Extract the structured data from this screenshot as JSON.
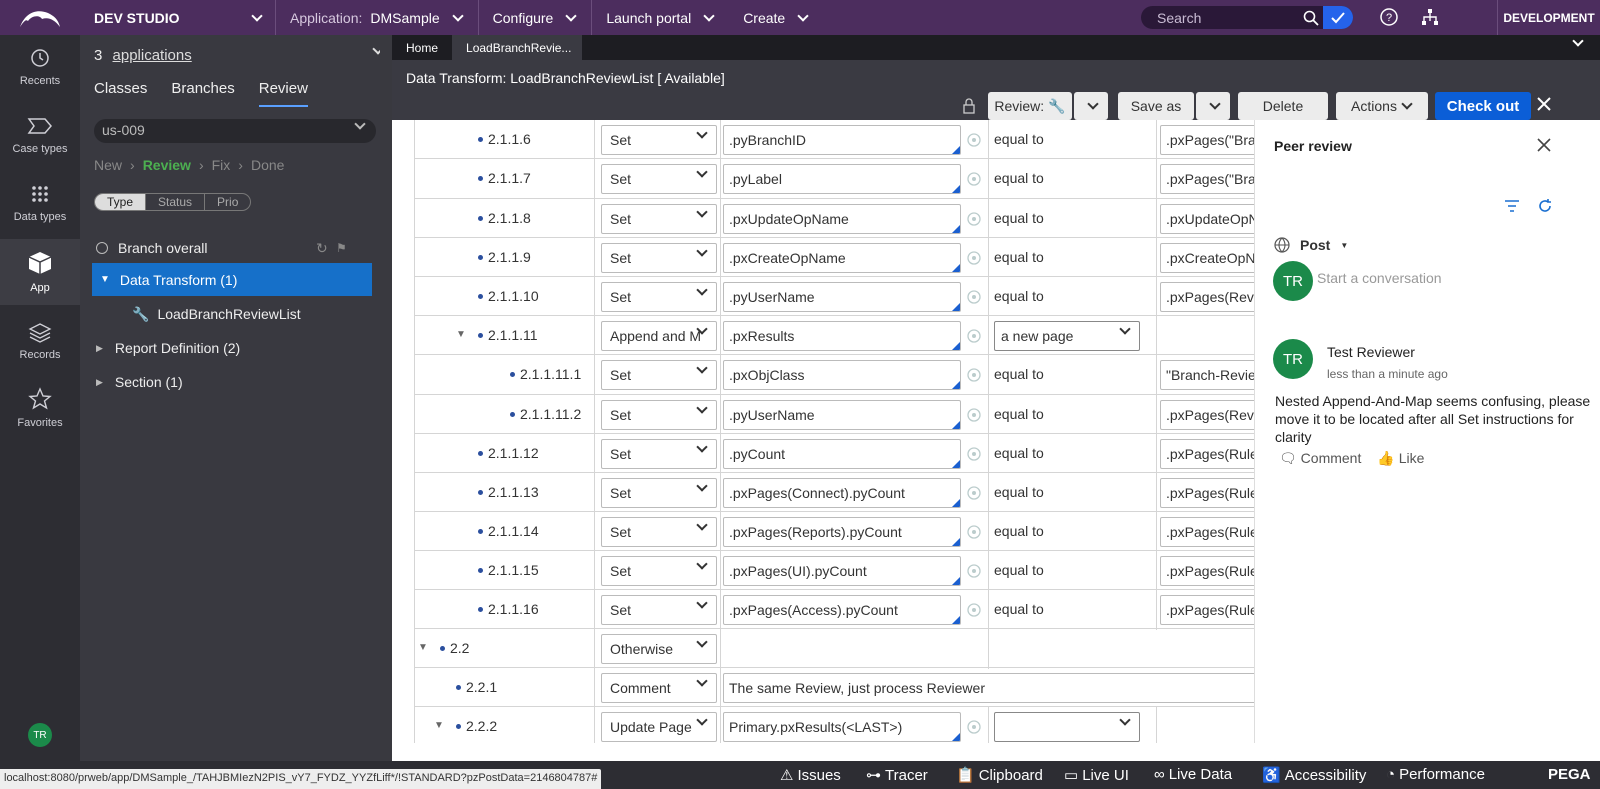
{
  "topbar": {
    "studio": "DEV STUDIO",
    "application_label": "Application:",
    "application_value": "DMSample",
    "configure": "Configure",
    "launch_portal": "Launch portal",
    "create": "Create",
    "search_placeholder": "Search",
    "environment": "DEVELOPMENT"
  },
  "rail": {
    "items": [
      {
        "label": "Recents",
        "icon": "history-icon"
      },
      {
        "label": "Case types",
        "icon": "case-types-icon"
      },
      {
        "label": "Data types",
        "icon": "data-types-icon"
      },
      {
        "label": "App",
        "icon": "app-cube-icon",
        "active": true
      },
      {
        "label": "Records",
        "icon": "records-icon"
      },
      {
        "label": "Favorites",
        "icon": "star-icon"
      }
    ],
    "avatar": "TR"
  },
  "panel": {
    "apps_count": "3",
    "apps_link": "applications",
    "tabs": [
      "Classes",
      "Branches",
      "Review"
    ],
    "selected_tab": "Review",
    "branch": "us-009",
    "flow": [
      "New",
      "Review",
      "Fix",
      "Done"
    ],
    "flow_current": "Review",
    "segments": [
      "Type",
      "Status",
      "Prio"
    ],
    "segment_selected": "Type",
    "branch_overall": "Branch overall",
    "tree": [
      {
        "label": "Data Transform (1)"
      },
      {
        "label": "LoadBranchReviewList"
      },
      {
        "label": "Report Definition (2)"
      },
      {
        "label": "Section (1)"
      }
    ]
  },
  "tabs": {
    "home": "Home",
    "current": "LoadBranchRevie..."
  },
  "header": {
    "title": "Data Transform: LoadBranchReviewList  [ Available]",
    "review": "Review:",
    "save_as": "Save as",
    "delete": "Delete",
    "actions": "Actions",
    "check_out": "Check out"
  },
  "grid": {
    "rows": [
      {
        "num": "2.1.1.6",
        "action": "Set",
        "target": ".pyBranchID",
        "op": "equal to",
        "value": ".pxPages(\"Bran"
      },
      {
        "num": "2.1.1.7",
        "action": "Set",
        "target": ".pyLabel",
        "op": "equal to",
        "value": ".pxPages(\"Bran"
      },
      {
        "num": "2.1.1.8",
        "action": "Set",
        "target": ".pxUpdateOpName",
        "op": "equal to",
        "value": ".pxUpdateOpN"
      },
      {
        "num": "2.1.1.9",
        "action": "Set",
        "target": ".pxCreateOpName",
        "op": "equal to",
        "value": ".pxCreateOpN"
      },
      {
        "num": "2.1.1.10",
        "action": "Set",
        "target": ".pyUserName",
        "op": "equal to",
        "value": ".pxPages(Revie"
      },
      {
        "num": "2.1.1.11",
        "action": "Append and M",
        "target": ".pxResults",
        "op": "a new page",
        "value": ""
      },
      {
        "num": "2.1.1.11.1",
        "action": "Set",
        "target": ".pxObjClass",
        "op": "equal to",
        "value": "\"Branch-Revie"
      },
      {
        "num": "2.1.1.11.2",
        "action": "Set",
        "target": ".pyUserName",
        "op": "equal to",
        "value": ".pxPages(Revie"
      },
      {
        "num": "2.1.1.12",
        "action": "Set",
        "target": ".pyCount",
        "op": "equal to",
        "value": ".pxPages(Rules"
      },
      {
        "num": "2.1.1.13",
        "action": "Set",
        "target": ".pxPages(Connect).pyCount",
        "op": "equal to",
        "value": ".pxPages(Rules"
      },
      {
        "num": "2.1.1.14",
        "action": "Set",
        "target": ".pxPages(Reports).pyCount",
        "op": "equal to",
        "value": ".pxPages(Rules"
      },
      {
        "num": "2.1.1.15",
        "action": "Set",
        "target": ".pxPages(UI).pyCount",
        "op": "equal to",
        "value": ".pxPages(Rules"
      },
      {
        "num": "2.1.1.16",
        "action": "Set",
        "target": ".pxPages(Access).pyCount",
        "op": "equal to",
        "value": ".pxPages(Rules"
      },
      {
        "num": "2.2",
        "action": "Otherwise",
        "target": "",
        "op": "",
        "value": ""
      },
      {
        "num": "2.2.1",
        "action": "Comment",
        "target": "The same Review, just process Reviewer",
        "op": "",
        "value": ""
      },
      {
        "num": "2.2.2",
        "action": "Update Page",
        "target": "Primary.pxResults(<LAST>)",
        "op": "",
        "value": ""
      }
    ]
  },
  "peer": {
    "title": "Peer review",
    "post": "Post",
    "start": "Start a conversation",
    "avatar": "TR",
    "comment": {
      "author": "Test Reviewer",
      "time": "less than a minute ago",
      "text": "Nested Append-And-Map seems confusing, please move it to be located after all Set instructions for clarity",
      "comment_label": "Comment",
      "like_label": "Like"
    }
  },
  "status": {
    "url": "localhost:8080/prweb/app/DMSample_/TAHJBMIezN2PIS_vY7_FYDZ_YYZfLiff*/!STANDARD?pzPostData=2146804787#",
    "items": [
      "Issues",
      "Tracer",
      "Clipboard",
      "Live UI",
      "Live Data",
      "Accessibility",
      "Performance"
    ],
    "brand": "PEGA"
  },
  "colors": {
    "topbar": "#4c2d5e",
    "accent": "#1670c9",
    "primary_button": "#0b5ed7",
    "avatar": "#1b8a4a"
  }
}
